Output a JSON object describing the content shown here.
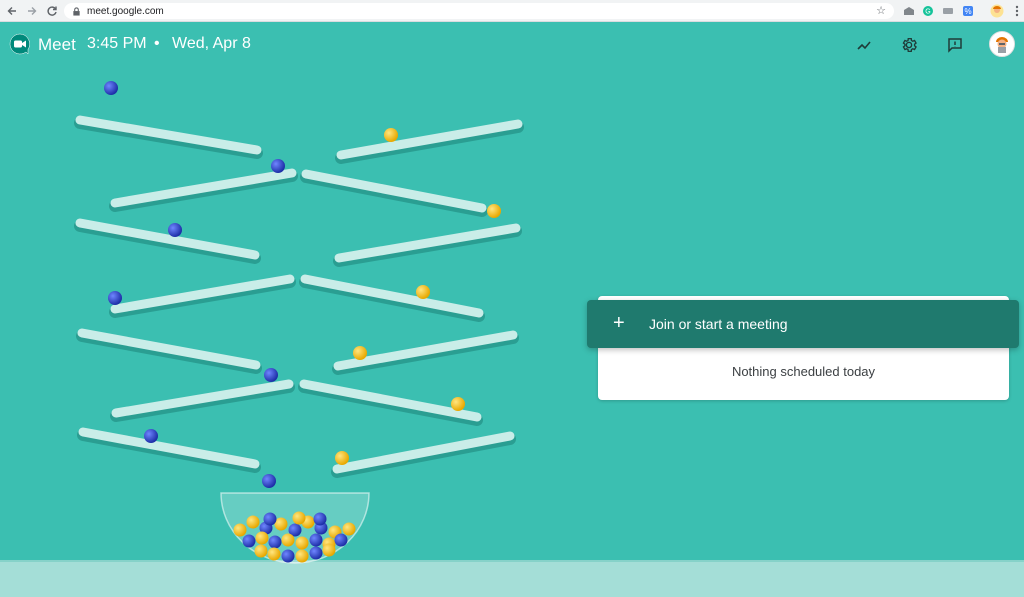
{
  "browser": {
    "url": "meet.google.com"
  },
  "header": {
    "app_name": "Meet",
    "time": "3:45 PM",
    "separator": "•",
    "date": "Wed, Apr 8"
  },
  "card": {
    "join_icon": "+",
    "join_label": "Join or start a meeting",
    "schedule_text": "Nothing scheduled today"
  },
  "icons": {
    "back": "arrow-left-icon",
    "forward": "arrow-right-icon",
    "reload": "reload-icon",
    "lock": "lock-icon",
    "bookmark": "star-icon",
    "trend": "trending-up-icon",
    "settings": "gear-icon",
    "feedback": "feedback-icon",
    "menu": "more-vert-icon"
  },
  "colors": {
    "background": "#3bbfb1",
    "join_bar": "#1f7a6e",
    "card": "#ffffff",
    "blue_ball": "#2a3fc0",
    "yellow_ball": "#f4c20d"
  }
}
